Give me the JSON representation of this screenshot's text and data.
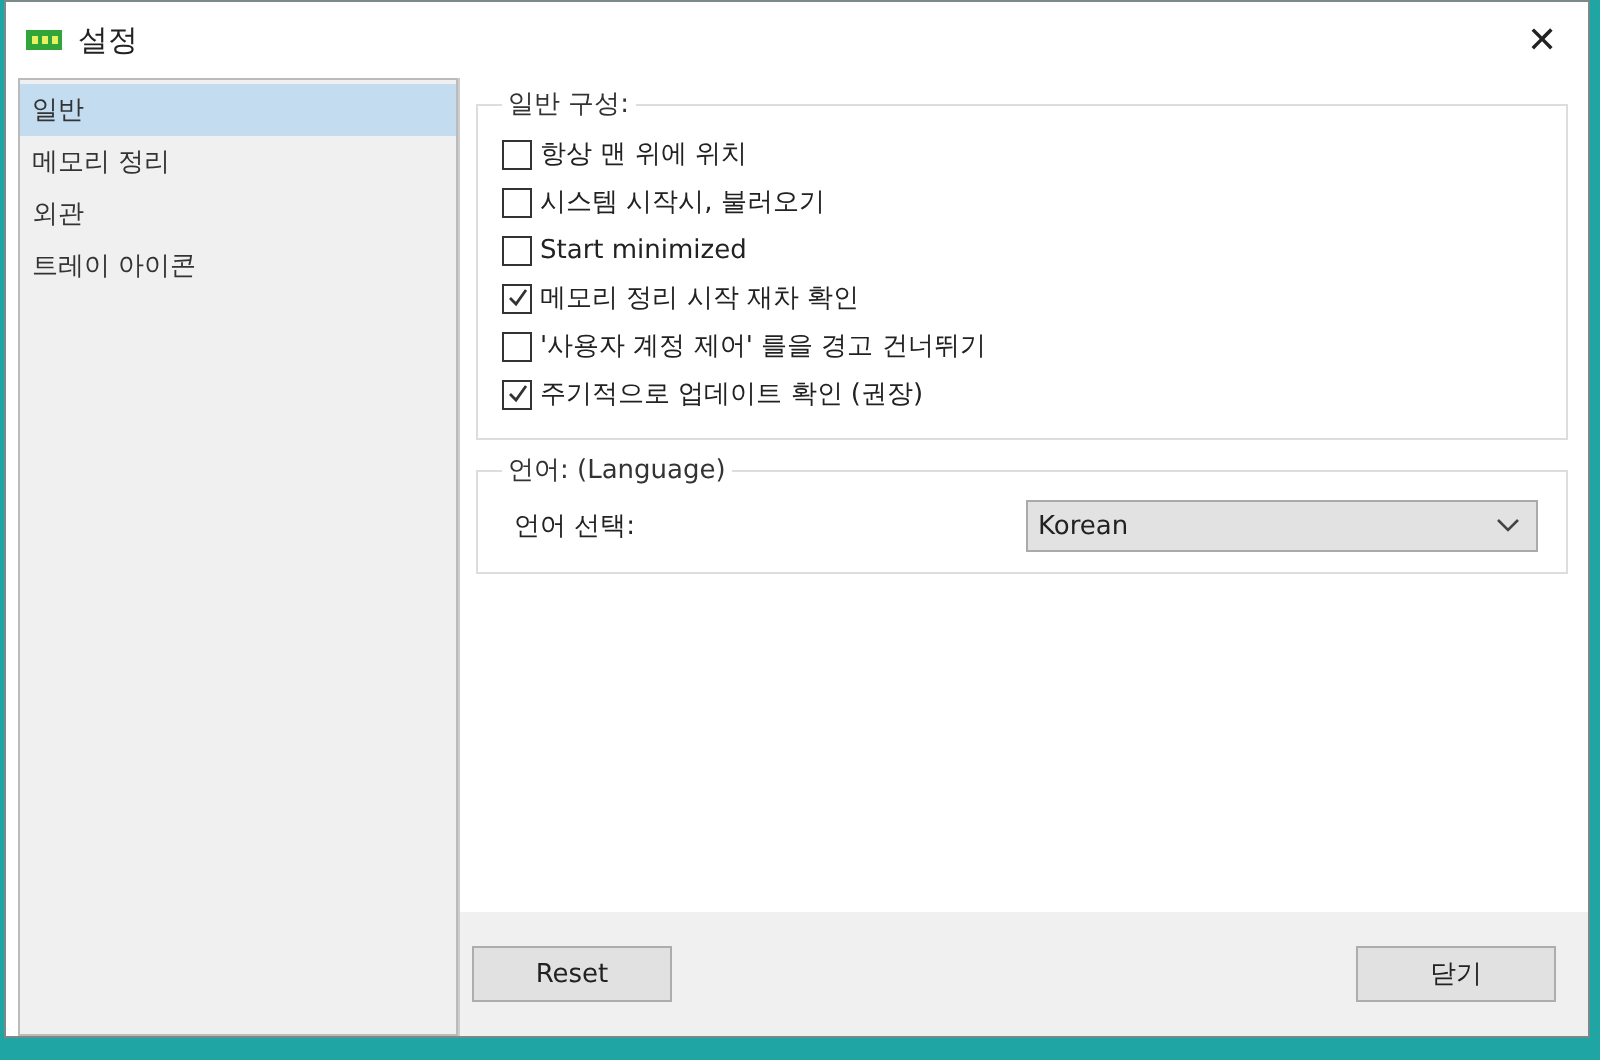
{
  "window": {
    "title": "설정",
    "close": "✕"
  },
  "sidebar": {
    "items": [
      {
        "label": "일반",
        "selected": true
      },
      {
        "label": "메모리 정리",
        "selected": false
      },
      {
        "label": "외관",
        "selected": false
      },
      {
        "label": "트레이 아이콘",
        "selected": false
      }
    ]
  },
  "general": {
    "title": "일반 구성:",
    "options": [
      {
        "label": "항상 맨 위에 위치",
        "checked": false
      },
      {
        "label": "시스템 시작시, 불러오기",
        "checked": false
      },
      {
        "label": "Start minimized",
        "checked": false
      },
      {
        "label": "메모리 정리 시작 재차 확인",
        "checked": true
      },
      {
        "label": "'사용자 계정 제어' 를을 경고 건너뛰기",
        "checked": false
      },
      {
        "label": "주기적으로 업데이트 확인 (권장)",
        "checked": true
      }
    ]
  },
  "language": {
    "title": "언어: (Language)",
    "label": "언어 선택:",
    "value": "Korean"
  },
  "buttons": {
    "reset": "Reset",
    "close": "닫기"
  }
}
